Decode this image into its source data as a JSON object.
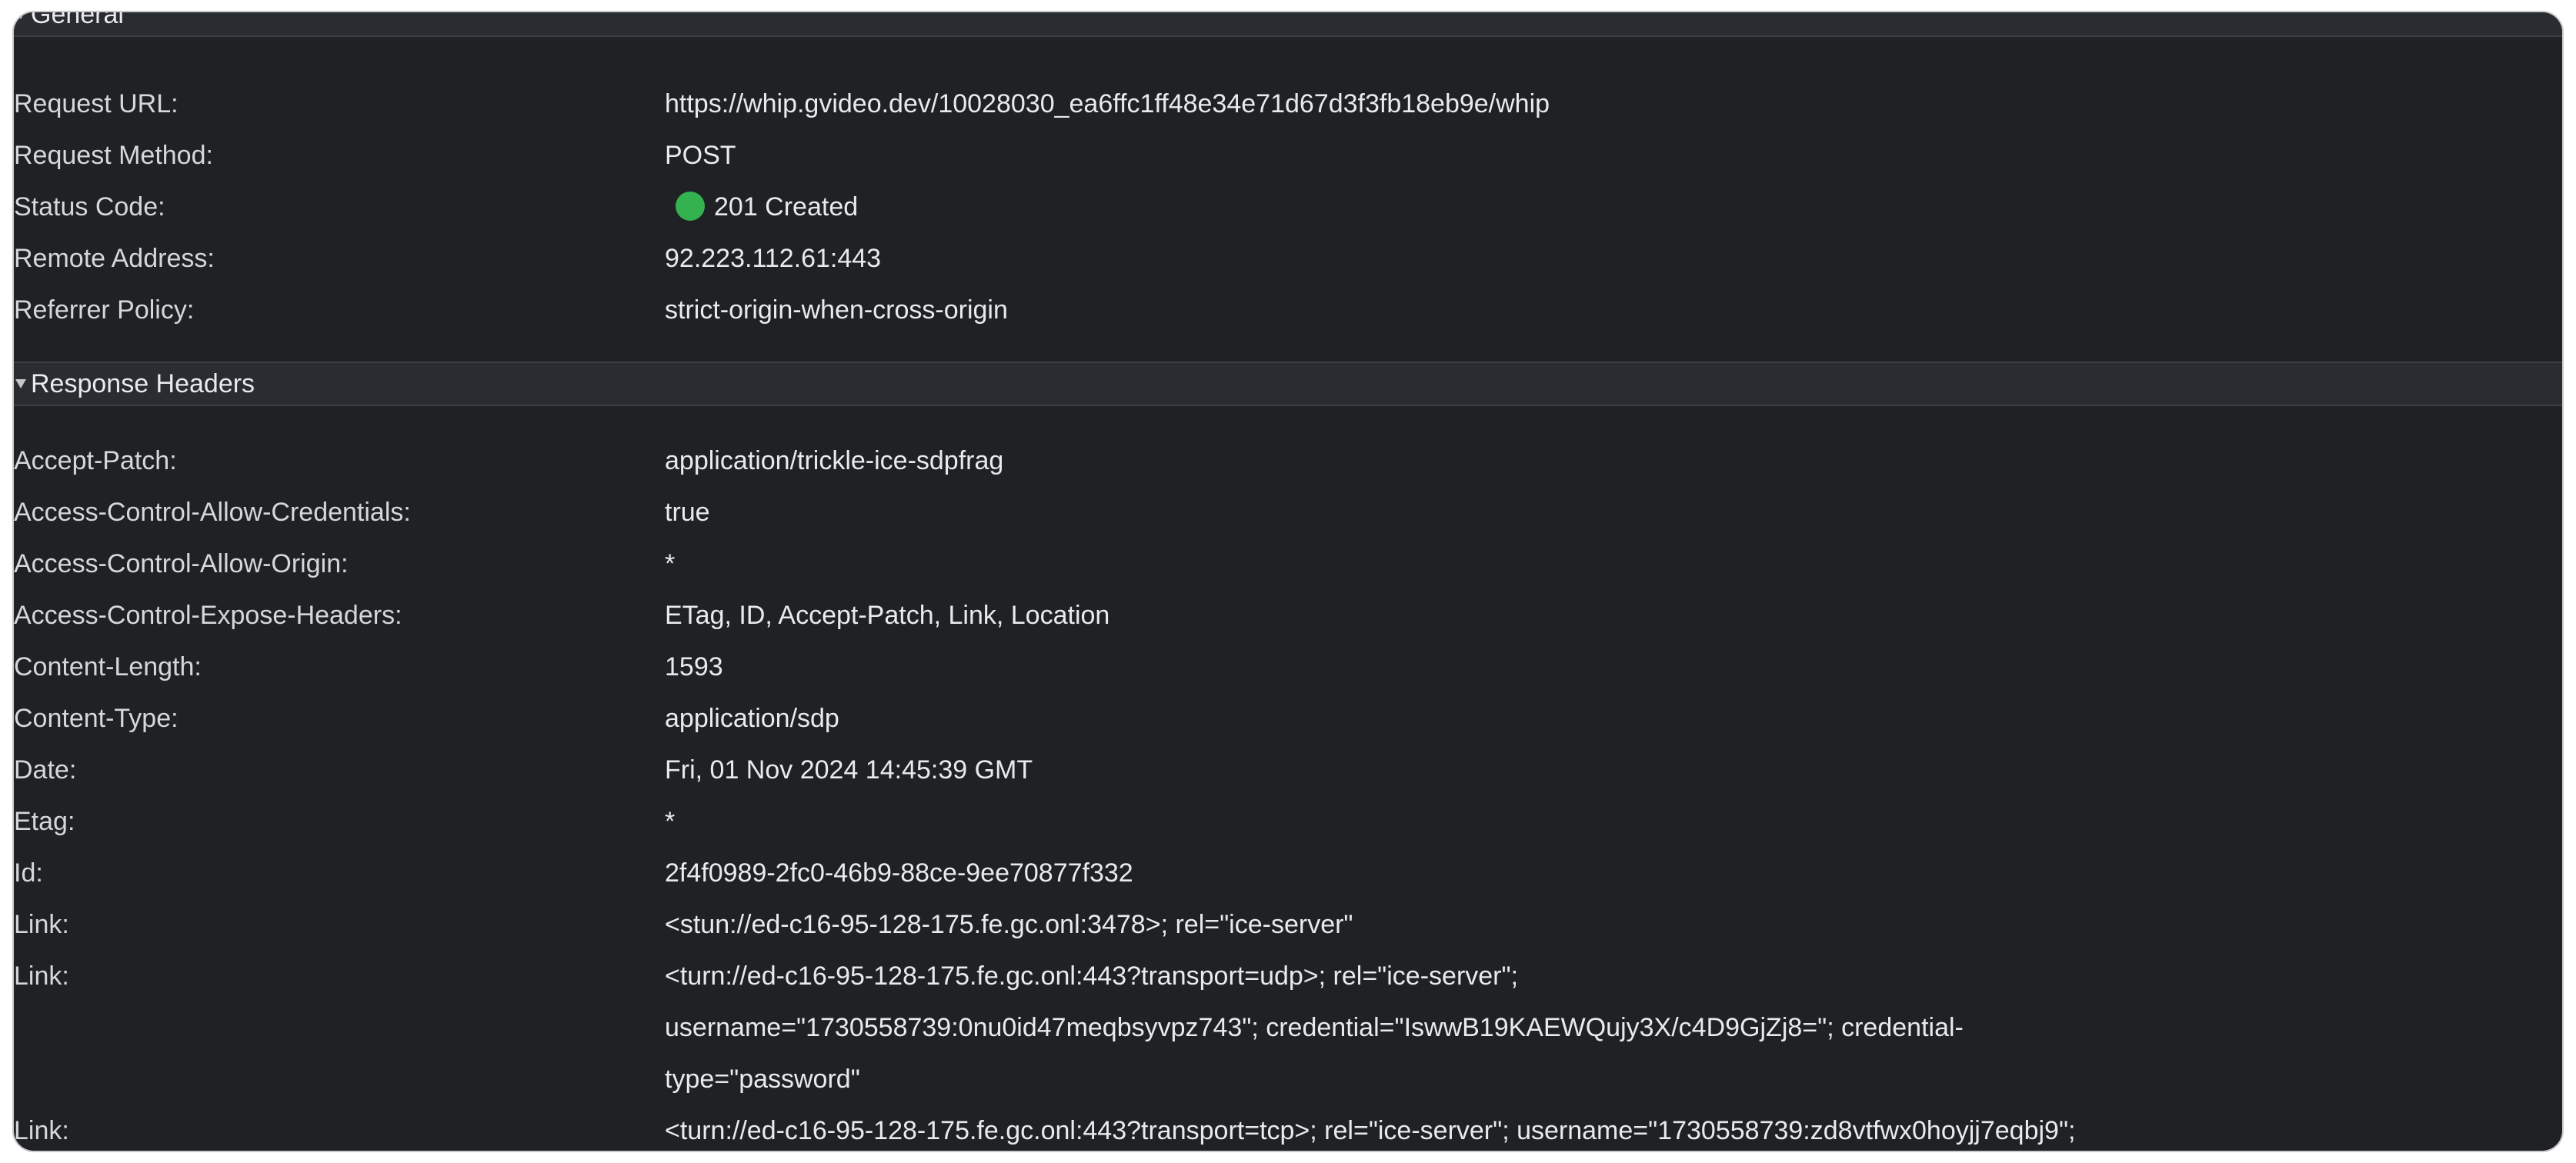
{
  "general": {
    "title": "General",
    "rows": {
      "request_url": {
        "key": "Request URL:",
        "value": "https://whip.gvideo.dev/10028030_ea6ffc1ff48e34e71d67d3f3fb18eb9e/whip"
      },
      "request_method": {
        "key": "Request Method:",
        "value": "POST"
      },
      "status_code": {
        "key": "Status Code:",
        "value": "201 Created",
        "status_color": "#34b24f"
      },
      "remote_address": {
        "key": "Remote Address:",
        "value": "92.223.112.61:443"
      },
      "referrer_policy": {
        "key": "Referrer Policy:",
        "value": "strict-origin-when-cross-origin"
      }
    }
  },
  "response_headers": {
    "title": "Response Headers",
    "rows": [
      {
        "key": "Accept-Patch:",
        "value": "application/trickle-ice-sdpfrag"
      },
      {
        "key": "Access-Control-Allow-Credentials:",
        "value": "true"
      },
      {
        "key": "Access-Control-Allow-Origin:",
        "value": "*"
      },
      {
        "key": "Access-Control-Expose-Headers:",
        "value": "ETag, ID, Accept-Patch, Link, Location"
      },
      {
        "key": "Content-Length:",
        "value": "1593"
      },
      {
        "key": "Content-Type:",
        "value": "application/sdp"
      },
      {
        "key": "Date:",
        "value": "Fri, 01 Nov 2024 14:45:39 GMT"
      },
      {
        "key": "Etag:",
        "value": "*"
      },
      {
        "key": "Id:",
        "value": "2f4f0989-2fc0-46b9-88ce-9ee70877f332"
      },
      {
        "key": "Link:",
        "value": "<stun://ed-c16-95-128-175.fe.gc.onl:3478>; rel=\"ice-server\""
      },
      {
        "key": "Link:",
        "value_lines": [
          "<turn://ed-c16-95-128-175.fe.gc.onl:443?transport=udp>; rel=\"ice-server\";",
          "username=\"1730558739:0nu0id47meqbsyvpz743\"; credential=\"IswwB19KAEWQujy3X/c4D9GjZj8=\"; credential-",
          "type=\"password\""
        ]
      },
      {
        "key": "Link:",
        "value": "<turn://ed-c16-95-128-175.fe.gc.onl:443?transport=tcp>; rel=\"ice-server\"; username=\"1730558739:zd8vtfwx0hoyjj7eqbj9\";"
      }
    ]
  }
}
